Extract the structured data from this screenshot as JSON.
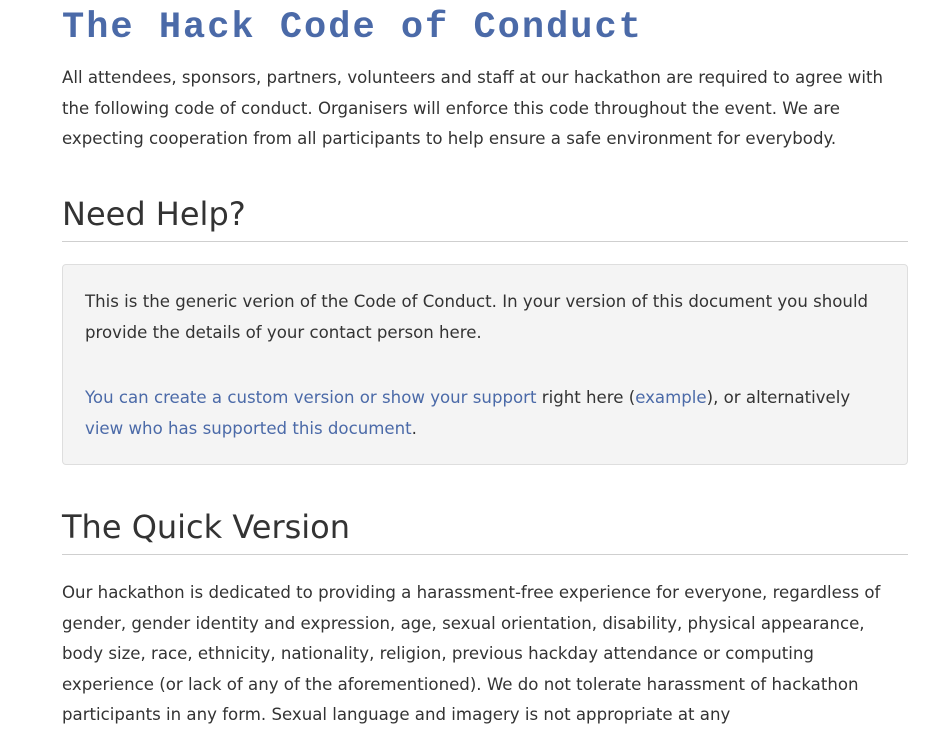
{
  "page": {
    "title": "The Hack Code of Conduct",
    "intro": "All attendees, sponsors, partners, volunteers and staff at our hackathon are required to agree with the following code of conduct. Organisers will enforce this code throughout the event. We are expecting cooperation from all participants to help ensure a safe environment for everybody."
  },
  "need_help": {
    "heading": "Need Help?",
    "paragraph1": "This is the generic verion of the Code of Conduct. In your version of this document you should provide the details of your contact person here.",
    "link_custom": "You can create a custom version or show your support",
    "text_right_here": " right here (",
    "link_example": "example",
    "text_alternatively": "), or alternatively ",
    "link_view_supporters": "view who has supported this document",
    "text_period": "."
  },
  "quick_version": {
    "heading": "The Quick Version",
    "body": "Our hackathon is dedicated to providing a harassment-free experience for everyone, regardless of gender, gender identity and expression, age, sexual orientation, disability, physical appearance, body size, race, ethnicity, nationality, religion, previous hackday attendance or computing experience (or lack of any of the aforementioned). We do not tolerate harassment of hackathon participants in any form. Sexual language and imagery is not appropriate at any"
  },
  "colors": {
    "title": "#4b6aa8",
    "link": "#4b6aa8",
    "text": "#333333",
    "box_background": "#f4f4f4",
    "rule": "#cfcfcf"
  }
}
